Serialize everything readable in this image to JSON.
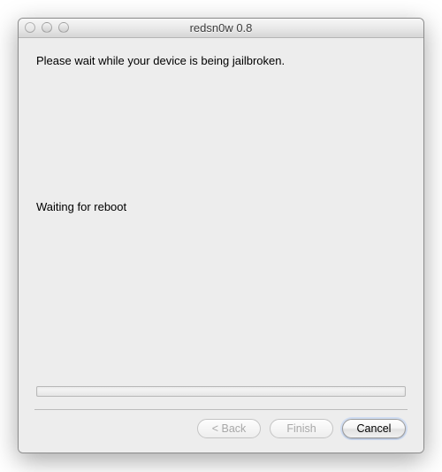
{
  "window": {
    "title": "redsn0w 0.8"
  },
  "main": {
    "instruction": "Please wait while your device is being jailbroken.",
    "status": "Waiting for reboot"
  },
  "progress": {
    "value": 0
  },
  "buttons": {
    "back": "< Back",
    "finish": "Finish",
    "cancel": "Cancel"
  },
  "buttons_enabled": {
    "back": false,
    "finish": false,
    "cancel": true
  }
}
